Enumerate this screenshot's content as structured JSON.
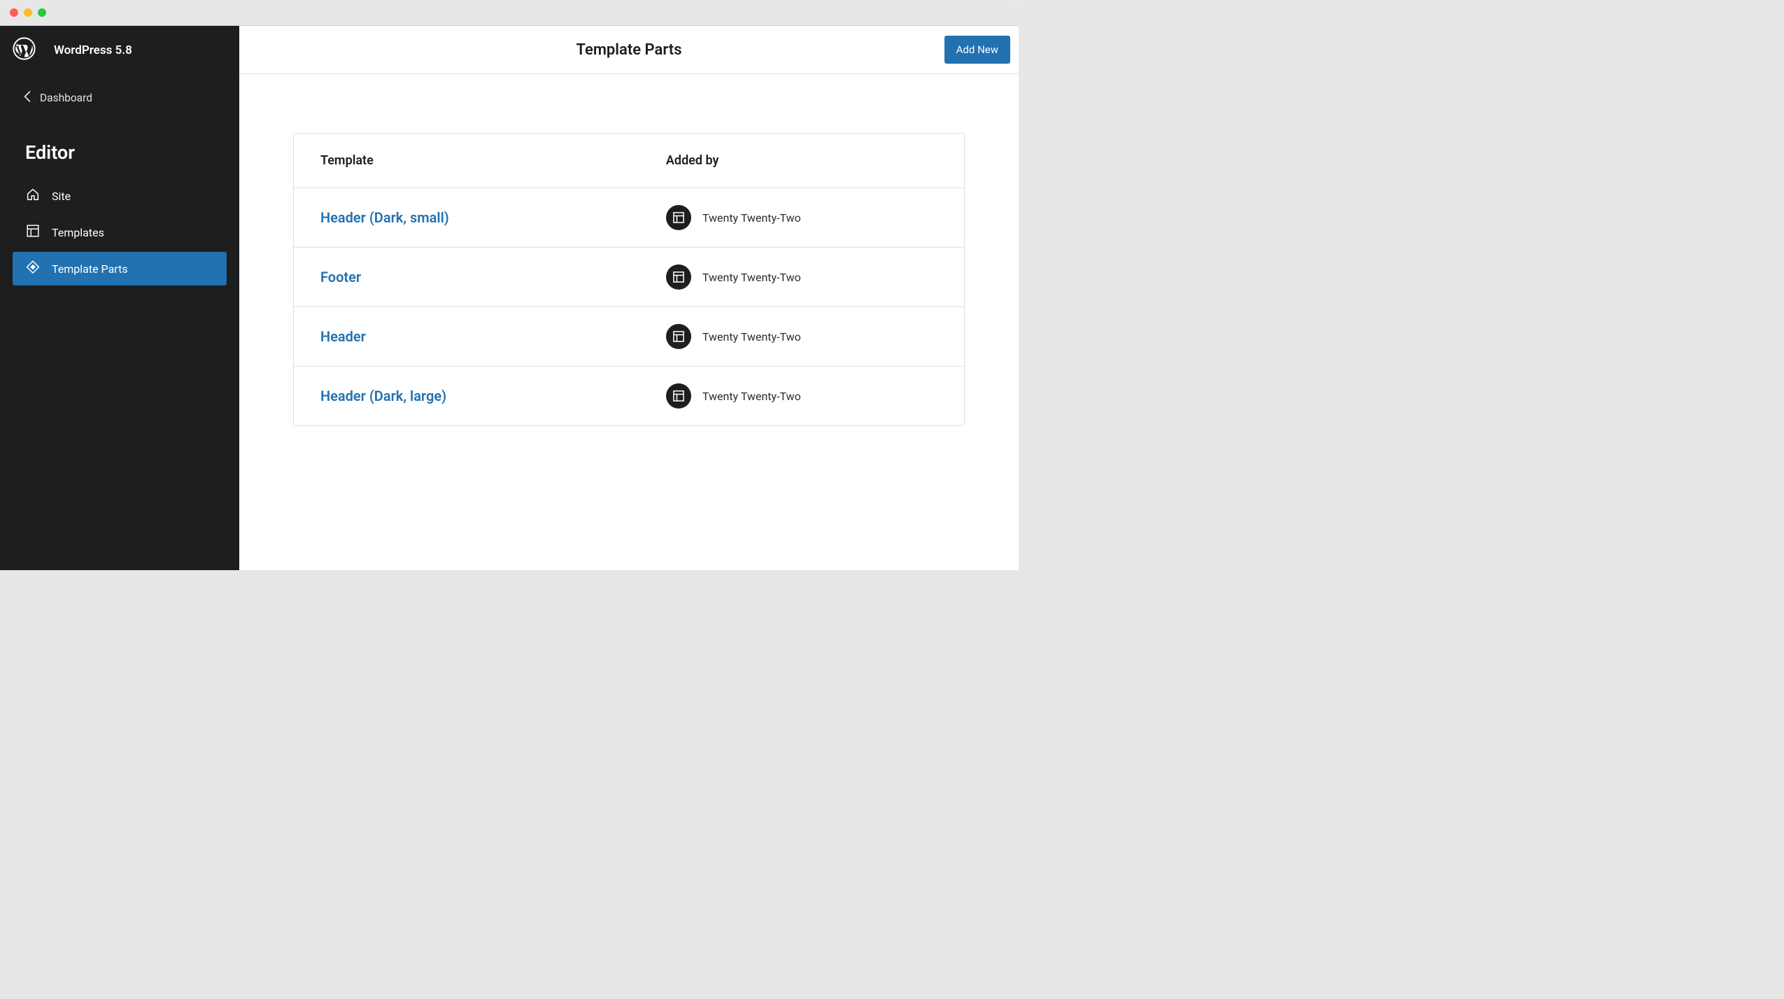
{
  "sidebar": {
    "product_title": "WordPress 5.8",
    "back_label": "Dashboard",
    "section_title": "Editor",
    "nav": [
      {
        "label": "Site"
      },
      {
        "label": "Templates"
      },
      {
        "label": "Template Parts"
      }
    ]
  },
  "header": {
    "title": "Template Parts",
    "add_new_label": "Add New"
  },
  "table": {
    "col_template": "Template",
    "col_added_by": "Added by",
    "rows": [
      {
        "name": "Header (Dark, small)",
        "added_by": "Twenty Twenty-Two"
      },
      {
        "name": "Footer",
        "added_by": "Twenty Twenty-Two"
      },
      {
        "name": "Header",
        "added_by": "Twenty Twenty-Two"
      },
      {
        "name": "Header (Dark, large)",
        "added_by": "Twenty Twenty-Two"
      }
    ]
  }
}
